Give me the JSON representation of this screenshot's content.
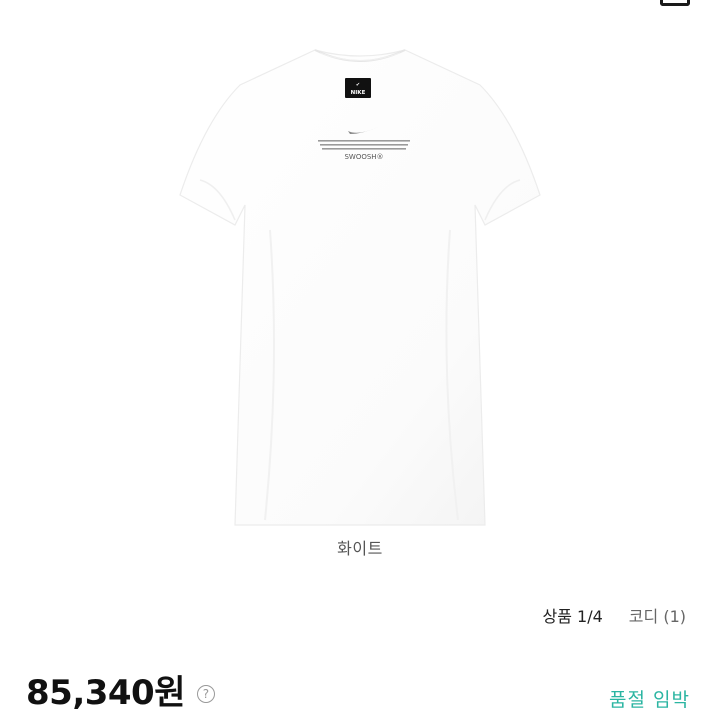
{
  "product": {
    "image_alt_icon": "tshirt-dress-image",
    "color_name": "화이트",
    "print_text_main": "SWOOSH®"
  },
  "tabs": {
    "product_label": "상품 1/4",
    "coordi_label": "코디 (1)"
  },
  "price": {
    "amount": "85,340원",
    "help_symbol": "?"
  },
  "status": {
    "stock_label": "품절 임박"
  },
  "colors": {
    "accent": "#2bb5a2",
    "price_text": "#111111"
  }
}
